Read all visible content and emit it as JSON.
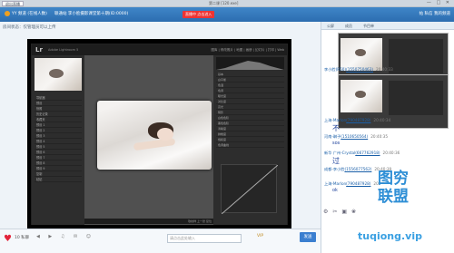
{
  "window": {
    "title": "第二课 [120.exe]",
    "tab": "退出直播",
    "controls": "— □ ✕"
  },
  "toolbar": {
    "channel1": "YY 频道 (在线人数)",
    "channel2": "联通站  李小脸摄影课堂第十期(ID:0000)",
    "live_tag": "直播中 点击进入",
    "right_text": "帖 私信 我的频道"
  },
  "status": "房间状态：仅管理员可以上传",
  "lightroom": {
    "logo": "Lr",
    "brand": "Adobe Lightroom 5",
    "modules": "图库 | 修改照片 | 地图 | 画册 | 幻灯片 | 打印 | Web",
    "left_rows": [
      "导航器",
      "预设",
      "快照",
      "历史记录",
      "收藏夹",
      "预设 1",
      "预设 2",
      "预设 3",
      "预设 4",
      "预设 5",
      "预设 6",
      "预设 7",
      "预设 8",
      "预设 9",
      "复制",
      "粘贴"
    ],
    "right_rows": [
      "基本",
      "白平衡",
      "色温",
      "色调",
      "曝光度",
      "对比度",
      "高光",
      "阴影",
      "白色色阶",
      "黑色色阶",
      "清晰度",
      "鲜艳度",
      "饱和度",
      "色调曲线"
    ],
    "bottom": "软校样 上一张 复位"
  },
  "chat": {
    "tabs": [
      "公屏",
      "成员",
      "节目单"
    ],
    "messages": [
      {
        "user": "李小脸(R50)",
        "id": "(1550750463)",
        "time": "20:40:33"
      },
      {
        "user": "上海-Marlon",
        "id": "(790487928)",
        "time": "20:40:34",
        "text": "不",
        "size": "big"
      },
      {
        "user": "河南-琳子",
        "id": "(1510650564)",
        "time": "20:40:35",
        "text": "sos",
        "size": "small"
      },
      {
        "user": "新华 广州-Crystal",
        "id": "(667762918)",
        "time": "20:40:36",
        "text": "过",
        "size": "big"
      },
      {
        "user": "成都-李小脸",
        "id": "(1556077562)",
        "time": "20:40:39",
        "text": "",
        "size": "small"
      },
      {
        "user": "上海-Marlon",
        "id": "(790487928)",
        "time": "20:40:40",
        "text": "ok",
        "size": "small"
      }
    ]
  },
  "bottombar": {
    "likes": "10  私聊",
    "controls": "◀ ▶ ♫ ✉ ☺",
    "input_placeholder": "请点击此处输入",
    "vip": "VIP",
    "send": "发送"
  },
  "watermark": {
    "line1": "图穷",
    "line2": "联盟",
    "url": "tuqiong.vip"
  },
  "colors": {
    "toolbar": "#2c6db0",
    "accent": "#3b7fd0",
    "heart": "#e2243b",
    "watermark": "#2f8fd6"
  }
}
